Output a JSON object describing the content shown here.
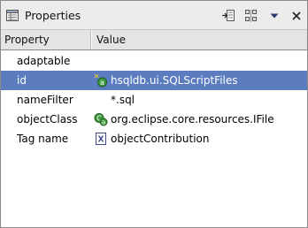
{
  "view": {
    "title": "Properties",
    "icon": "properties-view-icon",
    "toolbar": [
      {
        "name": "show-categories-button",
        "icon": "categories-icon"
      },
      {
        "name": "show-advanced-button",
        "icon": "advanced-properties-icon"
      },
      {
        "name": "view-menu-button",
        "icon": "chevron-down-icon"
      },
      {
        "name": "close-view-button",
        "icon": "close-icon"
      }
    ]
  },
  "table": {
    "columns": [
      "Property",
      "Value"
    ],
    "rows": [
      {
        "property": "adaptable",
        "value": "",
        "icon": null,
        "selected": false
      },
      {
        "property": "id",
        "value": "hsqldb.ui.SQLScriptFiles",
        "icon": "extension-id-icon",
        "selected": true
      },
      {
        "property": "nameFilter",
        "value": "*.sql",
        "icon": null,
        "selected": false
      },
      {
        "property": "objectClass",
        "value": "org.eclipse.core.resources.IFile",
        "icon": "class-icon",
        "selected": false
      },
      {
        "property": "Tag name",
        "value": "objectContribution",
        "icon": "xml-element-icon",
        "selected": false
      }
    ]
  },
  "colors": {
    "selection": "#5b7cbf",
    "header": "#e4e4e4",
    "titlebar": "#ececec"
  }
}
